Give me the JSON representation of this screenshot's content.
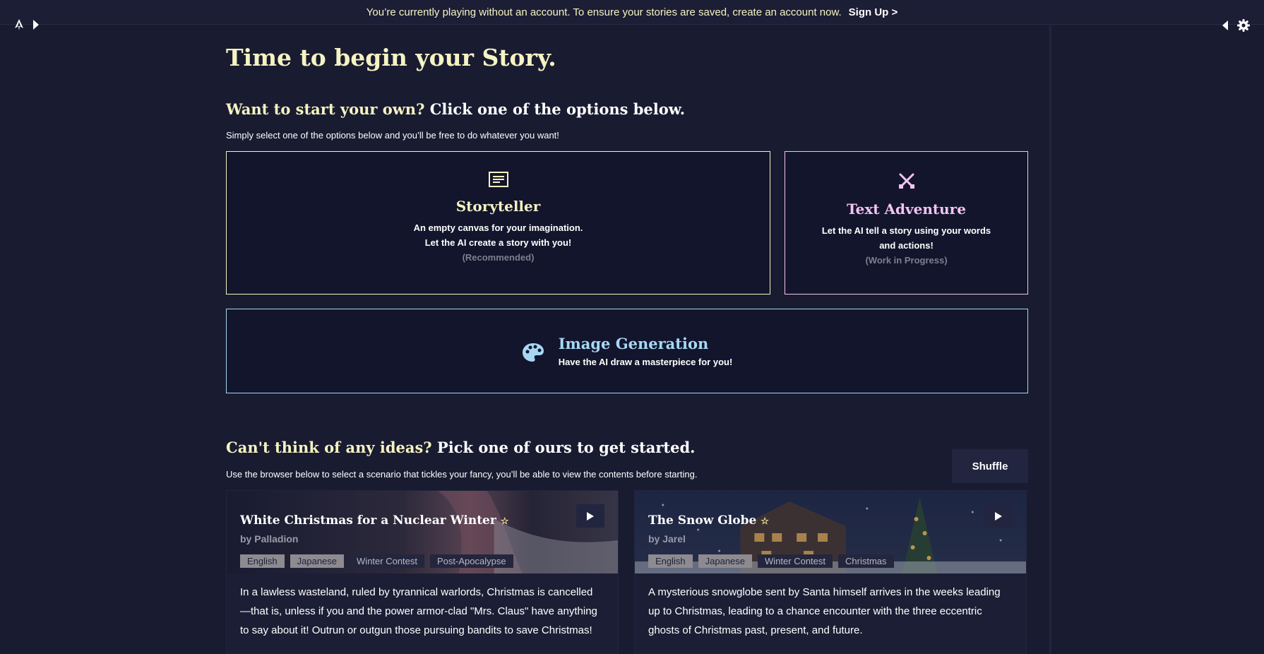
{
  "banner": {
    "message": "You’re currently playing without an account. To ensure your stories are saved, create an account now.",
    "signup_label": "Sign Up >"
  },
  "icons": {
    "logo": "quill-pen-icon",
    "expand_left": "caret-right-icon",
    "expand_right": "caret-left-icon",
    "settings": "gear-icon"
  },
  "header": {
    "title": "Time to begin your Story."
  },
  "start_section": {
    "heading_highlight": "Want to start your own?",
    "heading_rest": "Click one of the options below.",
    "subtitle": "Simply select one of the options below and you’ll be free to do whatever you want!"
  },
  "modes": {
    "storyteller": {
      "title": "Storyteller",
      "line1": "An empty canvas for your imagination.",
      "line2": "Let the AI create a story with you!",
      "note": "(Recommended)",
      "color": "#f5f3c2"
    },
    "adventure": {
      "title": "Text Adventure",
      "line1": "Let the AI tell a story using your words",
      "line2": "and actions!",
      "note": "(Work in Progress)",
      "color": "#f2c4f2"
    },
    "image": {
      "title": "Image Generation",
      "line1": "Have the AI draw a masterpiece for you!",
      "color": "#a6d8f5"
    }
  },
  "ideas_section": {
    "heading_highlight": "Can't think of any ideas?",
    "heading_rest": "Pick one of ours to get started.",
    "subtitle": "Use the browser below to select a scenario that tickles your fancy, you’ll be able to view the contents before starting.",
    "shuffle_label": "Shuffle"
  },
  "scenarios": [
    {
      "title": "White Christmas for a Nuclear Winter",
      "author": "by Palladion",
      "tags": [
        "English",
        "Japanese",
        "Winter Contest",
        "Post-Apocalypse"
      ],
      "description": "In a lawless wasteland, ruled by tyrannical warlords, Christmas is cancelled—that is, unless if you and the power armor-clad \"Mrs. Claus\" have anything to say about it! Outrun or outgun those pursuing bandits to save Christmas!"
    },
    {
      "title": "The Snow Globe",
      "author": "by Jarel",
      "tags": [
        "English",
        "Japanese",
        "Winter Contest",
        "Christmas"
      ],
      "description": "A mysterious snowglobe sent by Santa himself arrives in the weeks leading up to Christmas, leading to a chance encounter with the three eccentric ghosts of Christmas past, present, and future."
    }
  ]
}
